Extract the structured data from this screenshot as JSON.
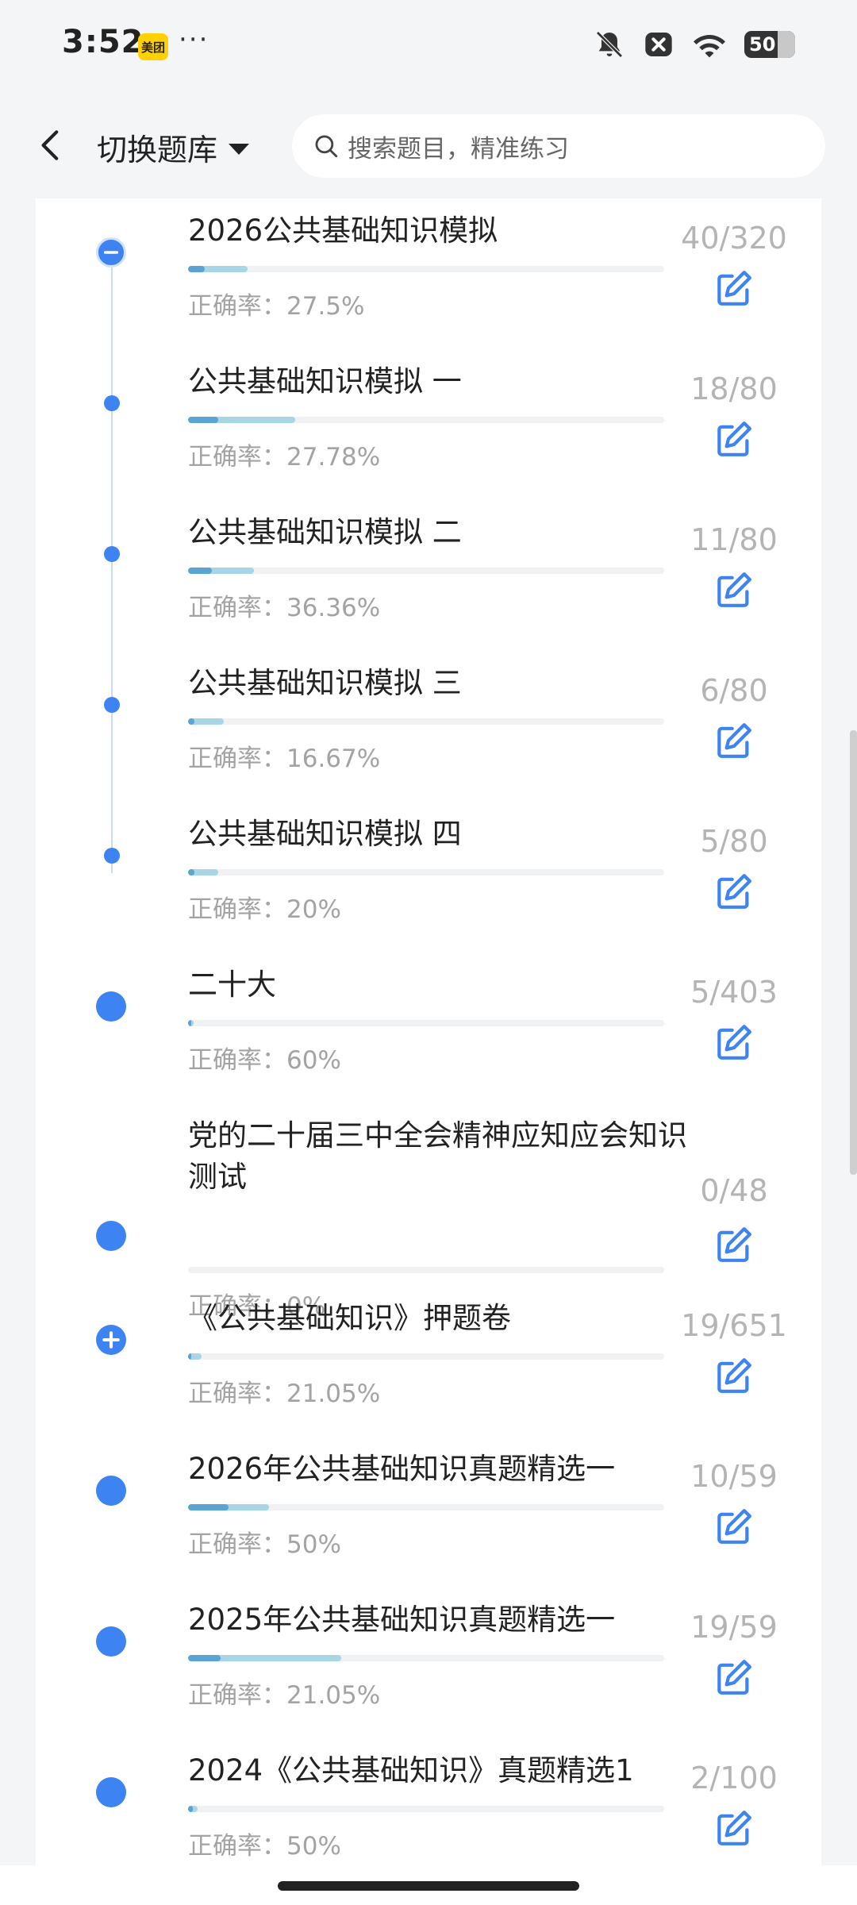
{
  "status_bar": {
    "time": "3:52",
    "app_badge": "美团",
    "more": "···",
    "battery": "50",
    "icons": [
      "bell-off-icon",
      "close-box-icon",
      "wifi-icon",
      "battery-icon"
    ]
  },
  "header": {
    "back_icon": "chevron-left-icon",
    "switch_label": "切换题库",
    "search_placeholder": "搜索题目，精准练习",
    "search_icon": "search-icon"
  },
  "accent_color": "#3d83f2",
  "items": [
    {
      "title": "2026公共基础知识模拟",
      "accuracy": "正确率：27.5%",
      "count": "40/320",
      "progress": 0.125,
      "correct_fraction": 0.275,
      "node": "collapse"
    },
    {
      "title": "公共基础知识模拟 一",
      "accuracy": "正确率：27.78%",
      "count": "18/80",
      "progress": 0.225,
      "correct_fraction": 0.278,
      "node": "small"
    },
    {
      "title": "公共基础知识模拟 二",
      "accuracy": "正确率：36.36%",
      "count": "11/80",
      "progress": 0.1375,
      "correct_fraction": 0.364,
      "node": "small"
    },
    {
      "title": "公共基础知识模拟 三",
      "accuracy": "正确率：16.67%",
      "count": "6/80",
      "progress": 0.075,
      "correct_fraction": 0.167,
      "node": "small"
    },
    {
      "title": "公共基础知识模拟 四",
      "accuracy": "正确率：20%",
      "count": "5/80",
      "progress": 0.0625,
      "correct_fraction": 0.2,
      "node": "small"
    },
    {
      "title": "二十大",
      "accuracy": "正确率：60%",
      "count": "5/403",
      "progress": 0.0124,
      "correct_fraction": 0.6,
      "node": "big"
    },
    {
      "title": "党的二十届三中全会精神应知应会知识测试",
      "accuracy": "正确率：0%",
      "count": "0/48",
      "progress": 0,
      "correct_fraction": 0,
      "node": "big"
    },
    {
      "title": "《公共基础知识》押题卷",
      "accuracy": "正确率：21.05%",
      "count": "19/651",
      "progress": 0.029,
      "correct_fraction": 0.21,
      "node": "expand"
    },
    {
      "title": "2026年公共基础知识真题精选一",
      "accuracy": "正确率：50%",
      "count": "10/59",
      "progress": 0.17,
      "correct_fraction": 0.5,
      "node": "big"
    },
    {
      "title": "2025年公共基础知识真题精选一",
      "accuracy": "正确率：21.05%",
      "count": "19/59",
      "progress": 0.322,
      "correct_fraction": 0.21,
      "node": "big"
    },
    {
      "title": "2024《公共基础知识》真题精选1",
      "accuracy": "正确率：50%",
      "count": "2/100",
      "progress": 0.02,
      "correct_fraction": 0.5,
      "node": "big"
    }
  ]
}
